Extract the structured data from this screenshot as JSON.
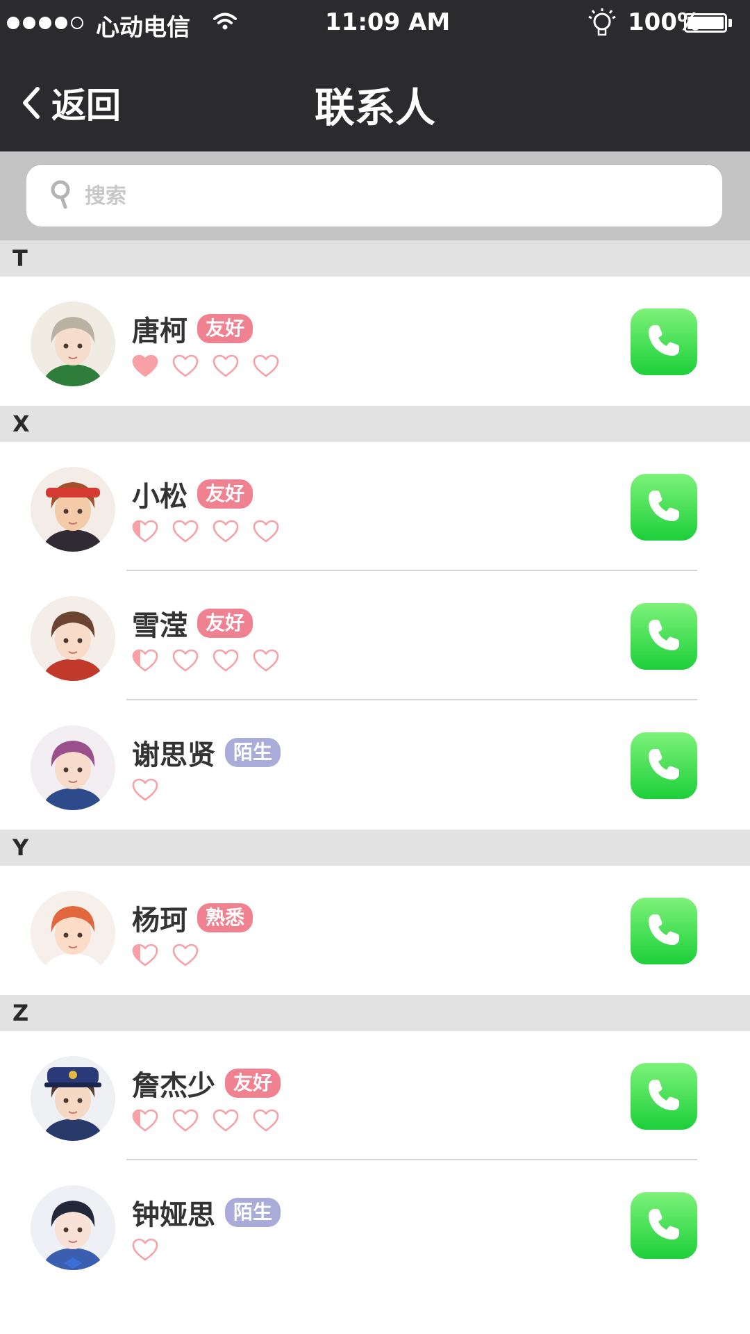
{
  "status_bar": {
    "carrier": "心动电信",
    "time": "11:09 AM",
    "battery": "100%",
    "signal_bars_filled": 4,
    "signal_bars_total": 5
  },
  "nav": {
    "back_label": "返回",
    "title": "联系人"
  },
  "search": {
    "placeholder": "搜索",
    "value": ""
  },
  "colors": {
    "header_bg": "#2b2b2d",
    "section_bg": "#e2e2e2",
    "call_green": "#2bd44a",
    "heart_pink": "#f7a1a6",
    "tag_friendly": "#f08190",
    "tag_stranger": "#a9acd9",
    "tag_familiar": "#f08190"
  },
  "sections": [
    {
      "letter": "T",
      "contacts": [
        {
          "name": "唐柯",
          "tag": "友好",
          "tag_style": "friendly",
          "hearts": [
            "full",
            "empty",
            "empty",
            "empty"
          ],
          "avatar": "male-glasses-green-jacket"
        }
      ]
    },
    {
      "letter": "X",
      "contacts": [
        {
          "name": "小松",
          "tag": "友好",
          "tag_style": "friendly",
          "hearts": [
            "half",
            "empty",
            "empty",
            "empty"
          ],
          "avatar": "male-red-bandana"
        },
        {
          "name": "雪滢",
          "tag": "友好",
          "tag_style": "friendly",
          "hearts": [
            "half",
            "empty",
            "empty",
            "empty"
          ],
          "avatar": "female-brown-hair"
        },
        {
          "name": "谢思贤",
          "tag": "陌生",
          "tag_style": "stranger",
          "hearts": [
            "empty"
          ],
          "avatar": "male-purple-hair"
        }
      ]
    },
    {
      "letter": "Y",
      "contacts": [
        {
          "name": "杨珂",
          "tag": "熟悉",
          "tag_style": "familiar",
          "hearts": [
            "half",
            "empty"
          ],
          "avatar": "female-red-hair"
        }
      ]
    },
    {
      "letter": "Z",
      "contacts": [
        {
          "name": "詹杰少",
          "tag": "友好",
          "tag_style": "friendly",
          "hearts": [
            "half",
            "empty",
            "empty",
            "empty"
          ],
          "avatar": "male-captain-hat"
        },
        {
          "name": "钟娅思",
          "tag": "陌生",
          "tag_style": "stranger",
          "hearts": [
            "empty"
          ],
          "avatar": "female-black-hair-bow"
        }
      ]
    }
  ]
}
